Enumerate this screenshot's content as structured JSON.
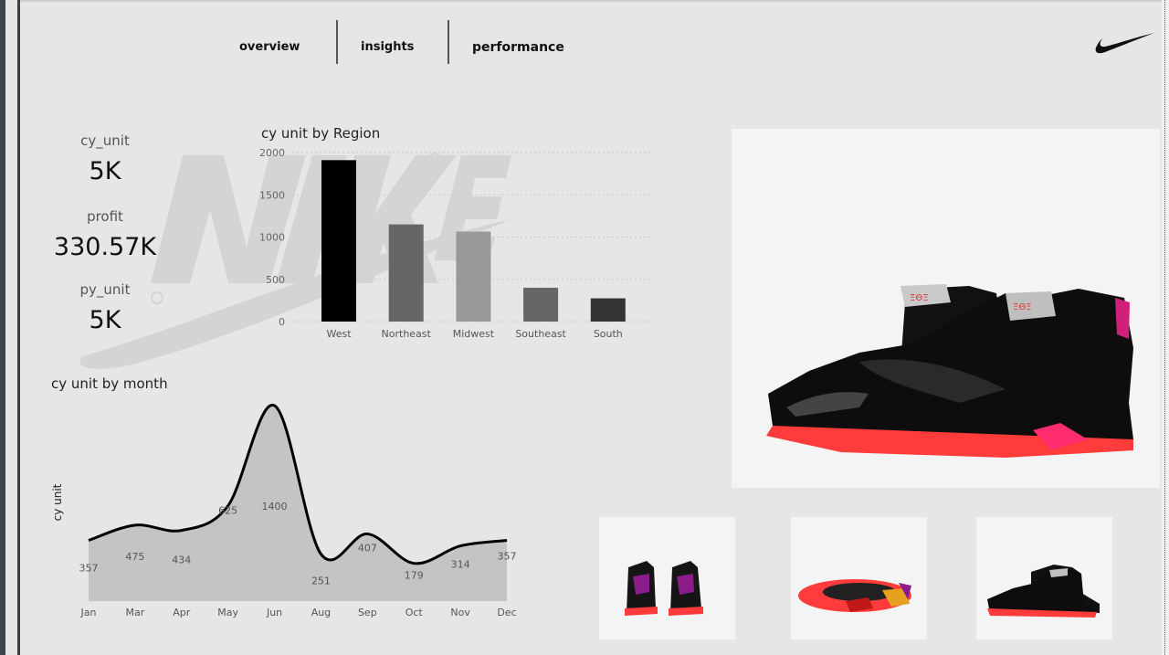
{
  "nav": {
    "items": [
      {
        "label": "overview"
      },
      {
        "label": "insights"
      },
      {
        "label": "performance"
      }
    ]
  },
  "kpis": [
    {
      "label": "cy_unit",
      "value": "5K"
    },
    {
      "label": "profit",
      "value": "330.57K"
    },
    {
      "label": "py_unit",
      "value": "5K"
    }
  ],
  "colors": {
    "background": "#e6e6e6",
    "accent_red": "#ff3b3b",
    "shoe_black": "#111111"
  },
  "chart_data": [
    {
      "type": "bar",
      "title": "cy unit by Region",
      "categories": [
        "West",
        "Northeast",
        "Midwest",
        "Southeast",
        "South"
      ],
      "values": [
        1910,
        1150,
        1065,
        400,
        275
      ],
      "bar_colors": [
        "#000000",
        "#666666",
        "#999999",
        "#666666",
        "#333333"
      ],
      "yticks": [
        0,
        500,
        1000,
        1500,
        2000
      ],
      "ylim": [
        0,
        2000
      ],
      "grid": true
    },
    {
      "type": "area",
      "title": "cy unit by month",
      "ylabel": "cy unit",
      "categories": [
        "Jan",
        "Mar",
        "Apr",
        "May",
        "Jun",
        "Aug",
        "Sep",
        "Oct",
        "Nov",
        "Dec"
      ],
      "values": [
        357,
        475,
        434,
        625,
        1400,
        251,
        407,
        179,
        314,
        357
      ],
      "grid": false
    }
  ],
  "icons": {
    "logo": "nike-swoosh-icon",
    "watermark": "nike-wordmark-watermark"
  },
  "images": {
    "hero": "product-shoe-pair-image",
    "thumbs": [
      "shoe-back-view-image",
      "shoe-sole-view-image",
      "shoe-side-view-image"
    ]
  }
}
